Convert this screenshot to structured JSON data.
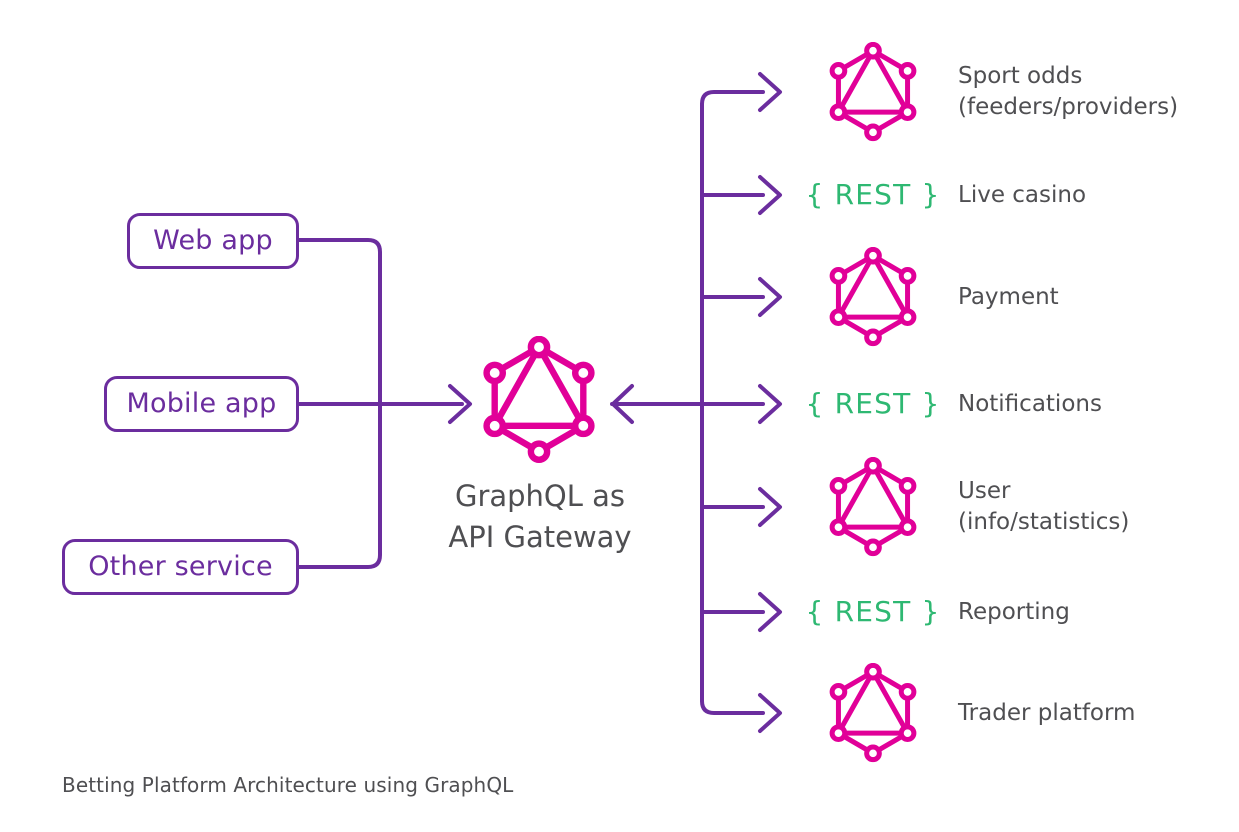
{
  "diagram": {
    "caption": "Betting Platform Architecture using GraphQL",
    "accent_purple": "#6b2d9e",
    "accent_magenta": "#e10098",
    "accent_green": "#2eb872",
    "text_color": "#4f4f52"
  },
  "clients": [
    {
      "label": "Web app",
      "icon": "rounded-rect"
    },
    {
      "label": "Mobile app",
      "icon": "rounded-rect"
    },
    {
      "label": "Other service",
      "icon": "rounded-rect"
    }
  ],
  "gateway": {
    "icon": "graphql-logo",
    "caption": "GraphQL as\nAPI Gateway",
    "caption_line1": "GraphQL as",
    "caption_line2": "API Gateway"
  },
  "services": [
    {
      "badge_type": "graphql",
      "badge_text": "",
      "label": "Sport odds\n(feeders/providers)"
    },
    {
      "badge_type": "rest",
      "badge_text": "{ REST }",
      "label": "Live casino"
    },
    {
      "badge_type": "graphql",
      "badge_text": "",
      "label": "Payment"
    },
    {
      "badge_type": "rest",
      "badge_text": "{ REST }",
      "label": "Notifications"
    },
    {
      "badge_type": "graphql",
      "badge_text": "",
      "label": "User\n(info/statistics)"
    },
    {
      "badge_type": "rest",
      "badge_text": "{ REST }",
      "label": "Reporting"
    },
    {
      "badge_type": "graphql",
      "badge_text": "",
      "label": "Trader platform"
    }
  ]
}
